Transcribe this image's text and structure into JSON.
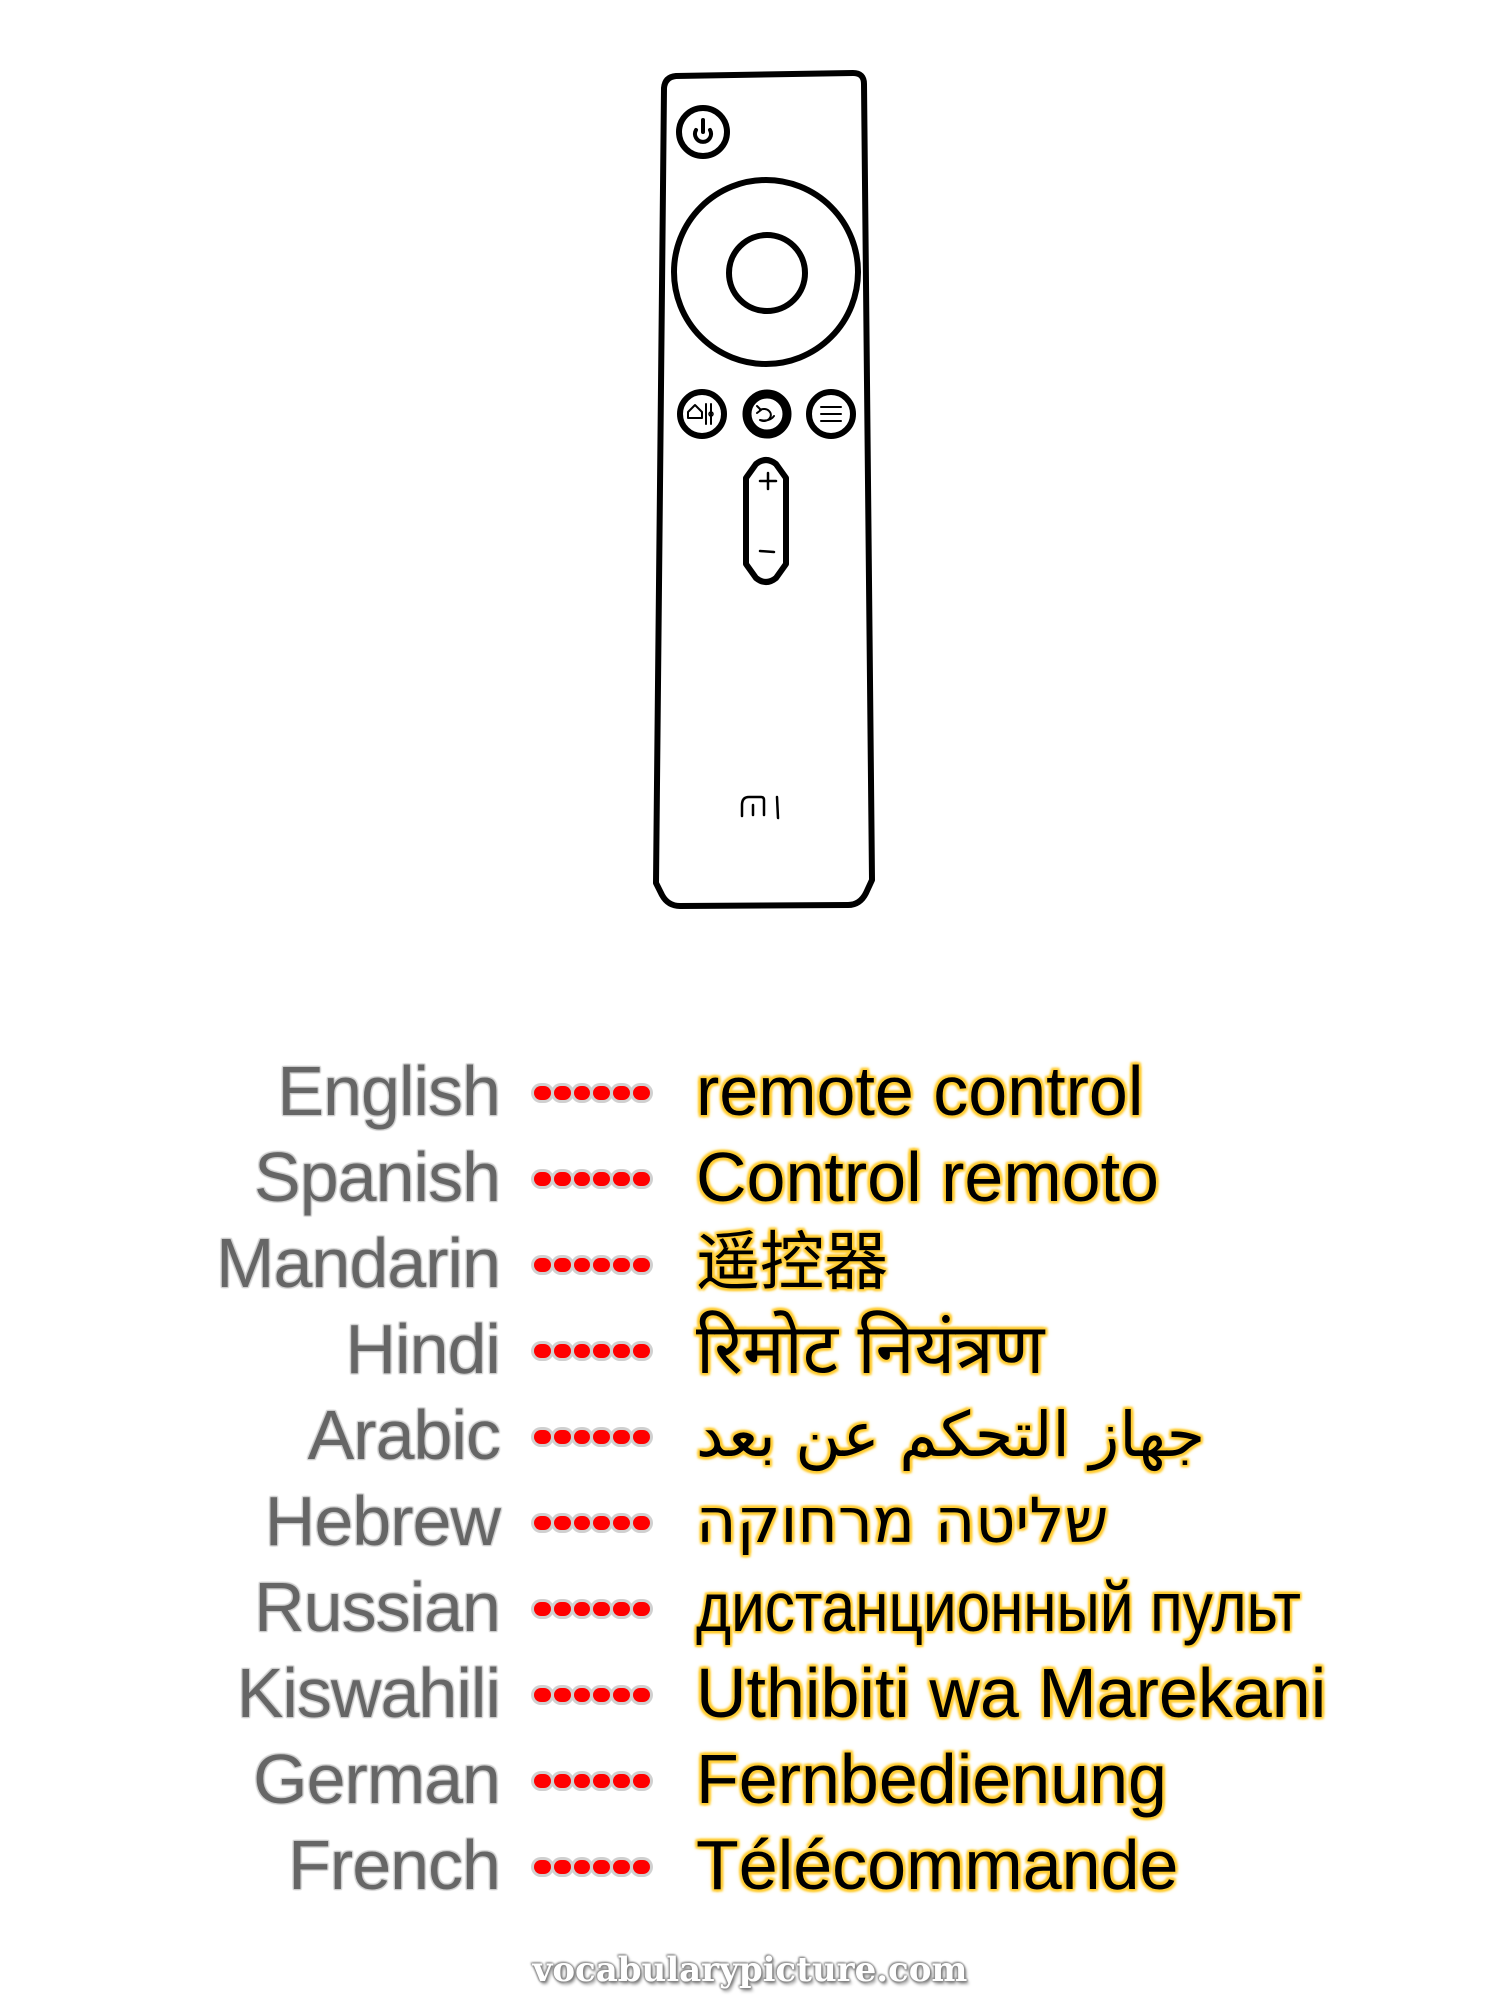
{
  "illustration": {
    "subject": "remote control",
    "icons": [
      "power-icon",
      "dpad-ring",
      "dpad-center-button",
      "home-icon",
      "back-icon",
      "menu-icon",
      "volume-plus-icon",
      "volume-minus-icon",
      "mi-logo"
    ],
    "logo_text": "MI"
  },
  "vocabulary": [
    {
      "language": "English",
      "translation": "remote control"
    },
    {
      "language": "Spanish",
      "translation": "Control remoto"
    },
    {
      "language": "Mandarin",
      "translation": "遥控器"
    },
    {
      "language": "Hindi",
      "translation": "रिमोट नियंत्रण"
    },
    {
      "language": "Arabic",
      "translation": "جهاز التحكم عن بعد"
    },
    {
      "language": "Hebrew",
      "translation": "שליטה מרחוקה"
    },
    {
      "language": "Russian",
      "translation": "дистанционный пульт"
    },
    {
      "language": "Kiswahili",
      "translation": "Uthibiti wa Marekani"
    },
    {
      "language": "German",
      "translation": "Fernbedienung"
    },
    {
      "language": "French",
      "translation": "Télécommande"
    }
  ],
  "colors": {
    "language_text": "#666666",
    "language_outline": "#cccccc",
    "dash": "#ff0000",
    "translation_text": "#000000",
    "translation_outline": "#ffcc33"
  },
  "footer": {
    "site": "vocabularypicture.com"
  }
}
